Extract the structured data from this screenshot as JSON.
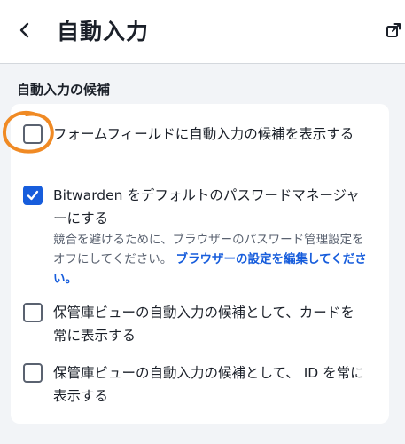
{
  "header": {
    "title": "自動入力",
    "back_icon": "chevron-left-icon",
    "popout_icon": "popout-icon"
  },
  "section": {
    "title": "自動入力の候補"
  },
  "options": [
    {
      "label": "フォームフィールドに自動入力の候補を表示する",
      "checked": false
    },
    {
      "label": "Bitwarden をデフォルトのパスワードマネージャーにする",
      "checked": true,
      "help_text": "競合を避けるために、ブラウザーのパスワード管理設定をオフにしてください。",
      "help_link": "ブラウザーの設定を編集してください。"
    },
    {
      "label": "保管庫ビューの自動入力の候補として、カードを常に表示する",
      "checked": false
    },
    {
      "label": "保管庫ビューの自動入力の候補として、 ID を常に表示する",
      "checked": false
    }
  ],
  "colors": {
    "accent": "#175ddc",
    "annotation": "#f08a24"
  }
}
